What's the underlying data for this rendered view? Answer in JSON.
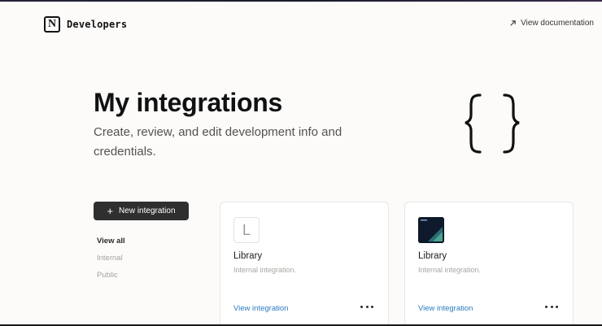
{
  "header": {
    "brand_logo_letter": "N",
    "brand_name": "Developers",
    "docs_link": "View documentation"
  },
  "hero": {
    "title": "My integrations",
    "subtitle": "Create, review, and edit development info and credentials."
  },
  "sidebar": {
    "new_button": "New integration",
    "filters": [
      {
        "label": "View all",
        "active": true
      },
      {
        "label": "Internal",
        "active": false
      },
      {
        "label": "Public",
        "active": false
      }
    ]
  },
  "cards": [
    {
      "icon_letter": "L",
      "name": "Library",
      "type": "Internal integration.",
      "link": "View integration"
    },
    {
      "icon_letter": "",
      "name": "Library",
      "type": "Internal integration.",
      "link": "View integration"
    }
  ],
  "colors": {
    "background": "#fcfbfa",
    "button_bg": "#2f2f2f",
    "link": "#2b7bc0"
  }
}
